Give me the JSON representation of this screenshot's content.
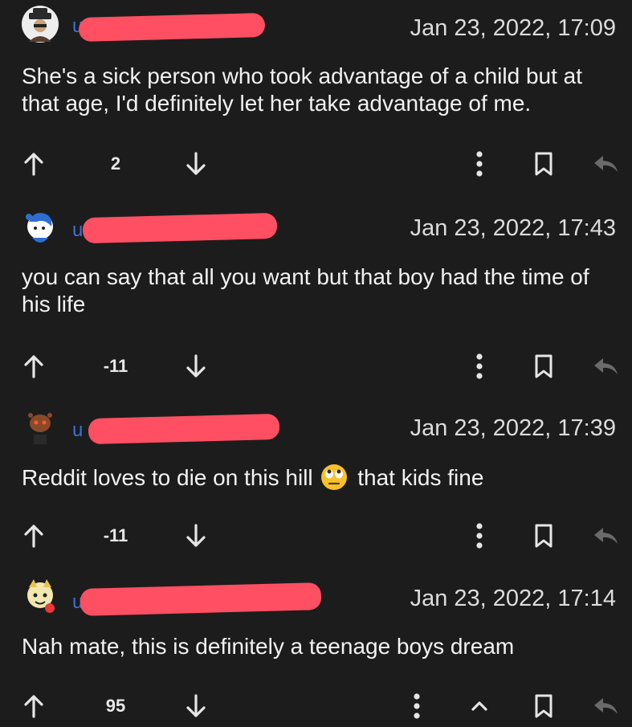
{
  "comments": [
    {
      "username_prefix": "u",
      "timestamp": "Jan 23, 2022, 17:09",
      "body": "She's a sick person who took advantage of a child but at that age, I'd definitely let her take advantage of me.",
      "score": "2",
      "has_collapse": false
    },
    {
      "username_prefix": "u",
      "timestamp": "Jan 23, 2022, 17:43",
      "body": "you can say that all you want but that boy had the time of his life",
      "score": "-11",
      "has_collapse": false
    },
    {
      "username_prefix": "u",
      "timestamp": "Jan 23, 2022, 17:39",
      "body_before_emoji": "Reddit loves to die on this hill",
      "body_after_emoji": "that kids fine",
      "emoji_icon": "face-with-rolling-eyes",
      "score": "-11",
      "has_collapse": false
    },
    {
      "username_prefix": "u",
      "timestamp": "Jan 23, 2022, 17:14",
      "body": "Nah mate, this is definitely a teenage boys dream",
      "score": "95",
      "has_collapse": true
    }
  ],
  "colors": {
    "background": "#1c1c1d",
    "text": "#f2f2f2",
    "icon": "#e6e6e6",
    "reply_icon_dim": "#6a6a6a",
    "redaction": "#ff4f62",
    "username_link": "#3a72d6"
  }
}
